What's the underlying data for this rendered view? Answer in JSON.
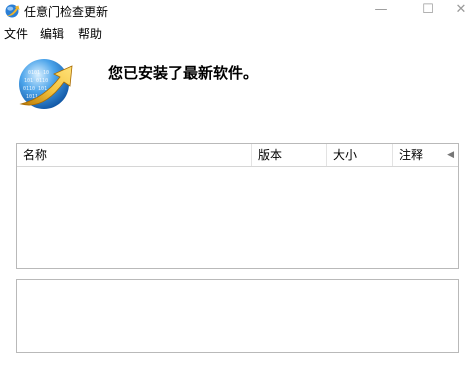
{
  "window": {
    "title": "任意门检查更新",
    "minimize_glyph": "—",
    "maximize_glyph": "☐",
    "close_glyph": "✕"
  },
  "menu": {
    "items": [
      "文件",
      "编辑",
      "帮助"
    ]
  },
  "header": {
    "message": "您已安装了最新软件。",
    "icon": "globe-update-icon"
  },
  "table": {
    "columns": [
      "名称",
      "版本",
      "大小",
      "注释"
    ],
    "rows": []
  },
  "details": {
    "text": ""
  },
  "colors": {
    "border": "#b9b9b9",
    "header_divider": "#d6d6d6",
    "globe_blue": "#1f6fc4",
    "arrow_gold": "#e2a21a"
  }
}
